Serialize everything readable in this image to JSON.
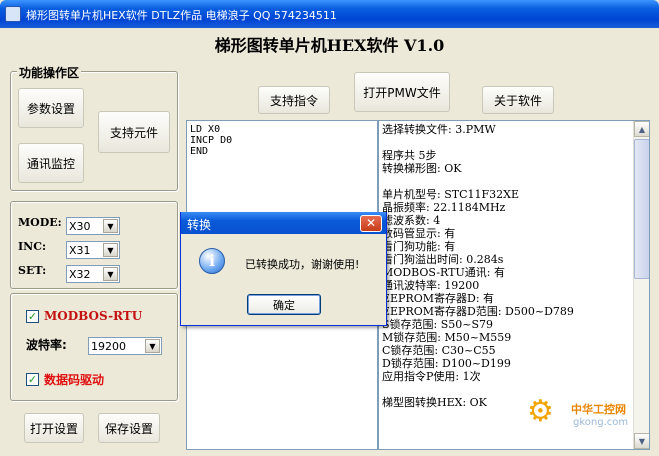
{
  "window": {
    "title": "梯形图转单片机HEX软件   DTLZ作品   电梯浪子 QQ 574234511"
  },
  "app_title": "梯形图转单片机HEX软件  V1.0",
  "function_panel": {
    "legend": "功能操作区",
    "param_settings_label": "参数设置",
    "supported_elements_label": "支持元件",
    "comm_monitor_label": "通讯监控"
  },
  "toolbar": {
    "supported_instructions_label": "支持指令",
    "open_pmw_label": "打开PMW文件",
    "about_label": "关于软件"
  },
  "settings": {
    "mode_label": "MODE:",
    "mode_value": "X30",
    "inc_label": "INC:",
    "inc_value": "X31",
    "set_label": "SET:",
    "set_value": "X32"
  },
  "comm": {
    "modbus_checked": true,
    "modbus_label": "MODBOS-RTU",
    "baud_label": "波特率:",
    "baud_value": "19200",
    "digit_drive_checked": true,
    "digit_drive_label": "数据码驱动"
  },
  "bottom_buttons": {
    "open_settings_label": "打开设置",
    "save_settings_label": "保存设置"
  },
  "program_lines": [
    "LD X0",
    "INCP D0",
    "END"
  ],
  "result_lines": [
    "选择转换文件: 3.PMW",
    "",
    "程序共 5步",
    "转换梯形图: OK",
    "",
    "单片机型号: STC11F32XE",
    "晶振频率: 22.1184MHz",
    "滤波系数: 4",
    "数码管显示: 有",
    "看门狗功能: 有",
    "看门狗溢出时间: 0.284s",
    "MODBOS-RTU通讯: 有",
    "通讯波特率: 19200",
    "EEPROM寄存器D: 有",
    "EEPROM寄存器D范围: D500~D789",
    "S锁存范围: S50~S79",
    "M锁存范围: M50~M559",
    "C锁存范围: C30~C55",
    "D锁存范围: D100~D199",
    "应用指令P使用: 1次",
    "",
    "梯型图转换HEX: OK"
  ],
  "dialog": {
    "title": "转换",
    "message": "已转换成功，谢谢使用!",
    "ok_label": "确定"
  },
  "watermark": {
    "brand": "中华工控网",
    "url": "gkong.com"
  }
}
